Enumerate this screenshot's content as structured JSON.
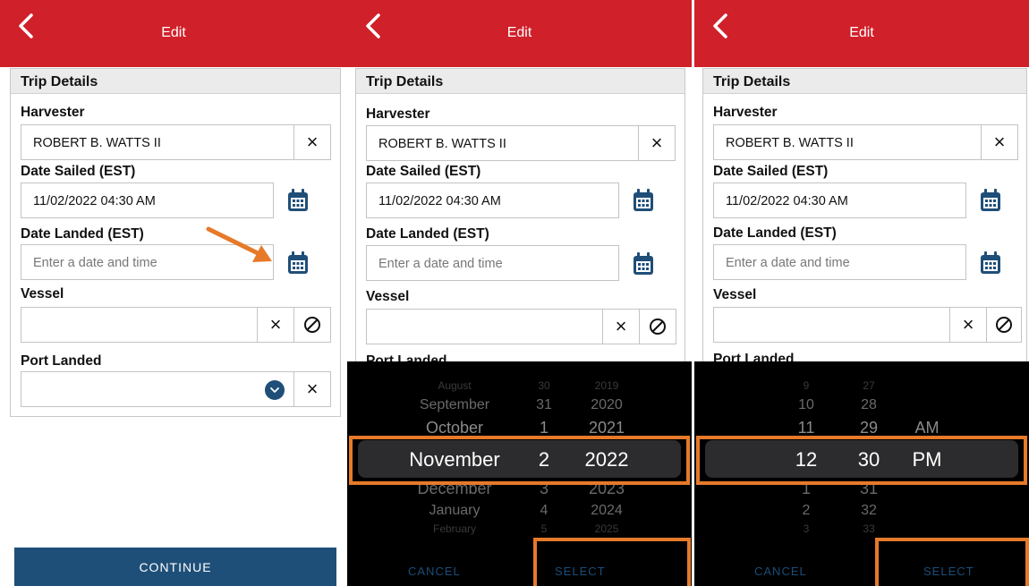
{
  "header": {
    "title": "Edit"
  },
  "card": {
    "title": "Trip Details"
  },
  "form": {
    "harvester_label": "Harvester",
    "harvester_value": "ROBERT B. WATTS II",
    "date_sailed_label": "Date Sailed (EST)",
    "date_sailed_value": "11/02/2022 04:30 AM",
    "date_landed_label": "Date Landed (EST)",
    "date_landed_placeholder": "Enter a date and time",
    "vessel_label": "Vessel",
    "port_landed_label": "Port Landed"
  },
  "icons": {
    "back": "chevron-left-icon",
    "clear": "×",
    "calendar": "calendar-icon",
    "ban": "ban-icon",
    "dropdown": "chevron-down-icon"
  },
  "continue_label": "CONTINUE",
  "date_picker": {
    "months": [
      "August",
      "September",
      "October",
      "November",
      "December",
      "January",
      "February"
    ],
    "days": [
      "30",
      "31",
      "1",
      "2",
      "3",
      "4",
      "5"
    ],
    "years": [
      "2019",
      "2020",
      "2021",
      "2022",
      "2023",
      "2024",
      "2025"
    ],
    "selected": {
      "month": "November",
      "day": "2",
      "year": "2022"
    },
    "cancel_label": "CANCEL",
    "select_label": "SELECT"
  },
  "time_picker": {
    "hours": [
      "9",
      "10",
      "11",
      "12",
      "1",
      "2",
      "3"
    ],
    "minutes": [
      "27",
      "28",
      "29",
      "30",
      "31",
      "32",
      "33"
    ],
    "periods": [
      "AM",
      "PM"
    ],
    "selected": {
      "hour": "12",
      "minute": "30",
      "period": "PM"
    },
    "cancel_label": "CANCEL",
    "select_label": "SELECT"
  },
  "colors": {
    "header": "#d0202a",
    "primary": "#1e4f78",
    "highlight": "#e67a2a",
    "picker_bg": "#000000"
  }
}
